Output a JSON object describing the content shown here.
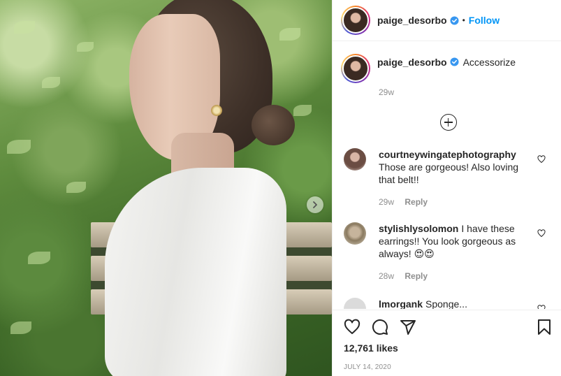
{
  "post": {
    "image_alt": "Woman in white t-shirt wearing earrings in front of hedge",
    "username": "paige_desorbo",
    "follow_separator": "•",
    "follow_label": "Follow",
    "caption": "Accessorize",
    "caption_time": "29w",
    "likes": "12,761 likes",
    "date": "JULY 14, 2020"
  },
  "comments": [
    {
      "user": "courtneywingatephotography",
      "text": "Those are gorgeous! Also loving that belt!!",
      "time": "29w",
      "reply": "Reply"
    },
    {
      "user": "stylishlysolomon",
      "text": "I have these earrings!! You look gorgeous as always! 😍😍",
      "time": "28w",
      "reply": "Reply"
    },
    {
      "user": "lmorgank",
      "text": "Sponge..."
    }
  ],
  "icons": {
    "verified": "verified-badge-icon",
    "like": "heart-icon",
    "comment": "comment-icon",
    "share": "paper-plane-icon",
    "save": "bookmark-icon",
    "load_more": "plus-circle-icon",
    "carousel_next": "chevron-right-icon"
  },
  "colors": {
    "accent": "#0095f6",
    "text": "#262626",
    "muted": "#8e8e8e",
    "divider": "#efefef"
  }
}
